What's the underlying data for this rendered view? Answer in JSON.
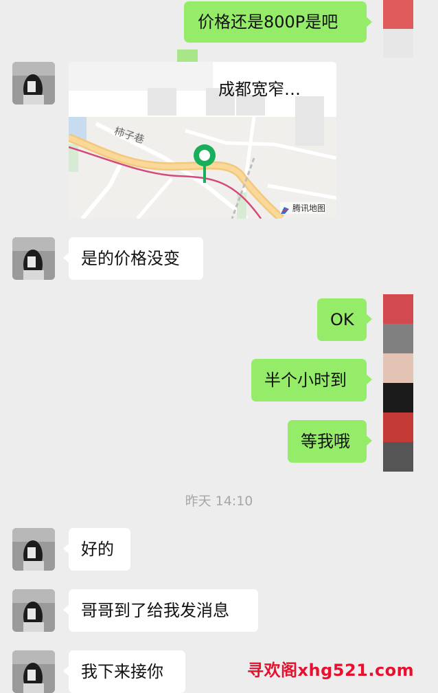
{
  "messages": {
    "m1": "价格还是800P是吧",
    "m3": "是的价格没变",
    "m4": "OK",
    "m5": "半个小时到",
    "m6": "等我哦",
    "m7": "好的",
    "m8": "哥哥到了给我发消息",
    "m9": "我下来接你"
  },
  "location_card": {
    "title_fragment": "成都宽窄…",
    "street_label": "柿子巷",
    "map_brand": "腾讯地图"
  },
  "timestamp": "昨天 14:10",
  "watermark": "寻欢阁xhg521.com",
  "colors": {
    "background": "#ededed",
    "my_bubble": "#95ec69",
    "their_bubble": "#ffffff",
    "pin": "#1aad5b"
  },
  "icons": {
    "pin": "location-pin-icon",
    "brand": "tencent-maps-logo-icon"
  }
}
